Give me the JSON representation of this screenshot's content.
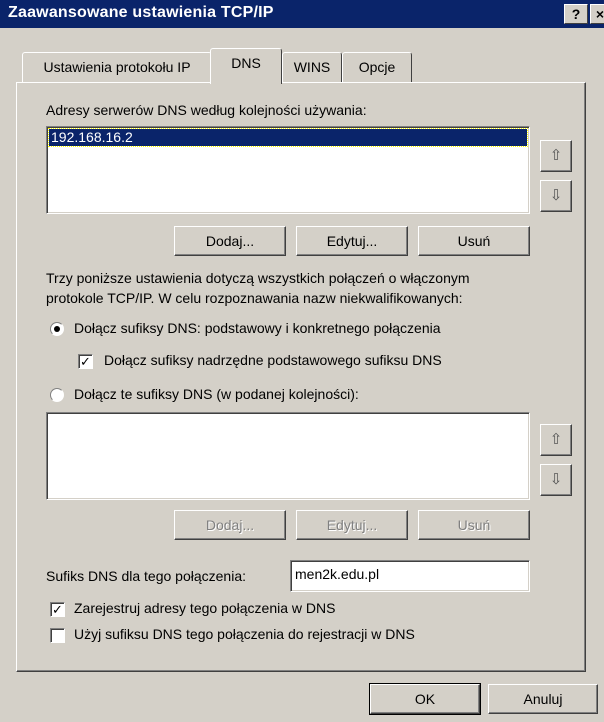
{
  "window": {
    "title": "Zaawansowane ustawienia TCP/IP",
    "help_label": "?",
    "close_label": "×"
  },
  "tabs": [
    {
      "label": "Ustawienia protokołu IP",
      "active": false
    },
    {
      "label": "DNS",
      "active": true
    },
    {
      "label": "WINS",
      "active": false
    },
    {
      "label": "Opcje",
      "active": false
    }
  ],
  "dns": {
    "servers_label": "Adresy serwerów DNS według kolejności używania:",
    "servers": [
      "192.168.16.2"
    ],
    "up_icon": "arrow-up-icon",
    "down_icon": "arrow-down-icon",
    "add_label": "Dodaj...",
    "edit_label": "Edytuj...",
    "remove_label": "Usuń",
    "info_text_line1": "Trzy poniższe ustawienia dotyczą wszystkich połączeń o włączonym",
    "info_text_line2": "protokole TCP/IP. W celu rozpoznawania nazw niekwalifikowanych:",
    "radio_primary_label": "Dołącz sufiksy DNS: podstawowy i konkretnego połączenia",
    "radio_primary_checked": true,
    "check_parent_label": "Dołącz sufiksy nadrzędne podstawowego sufiksu DNS",
    "check_parent_checked": true,
    "radio_custom_label": "Dołącz te sufiksy DNS (w podanej kolejności):",
    "radio_custom_checked": false,
    "suffixes": [],
    "suffix_add_label": "Dodaj...",
    "suffix_edit_label": "Edytuj...",
    "suffix_remove_label": "Usuń",
    "conn_suffix_label": "Sufiks DNS dla tego połączenia:",
    "conn_suffix_value": "men2k.edu.pl",
    "register_label": "Zarejestruj adresy tego połączenia w DNS",
    "register_checked": true,
    "use_suffix_label": "Użyj sufiksu DNS tego połączenia do rejestracji w DNS",
    "use_suffix_checked": false
  },
  "footer": {
    "ok_label": "OK",
    "cancel_label": "Anuluj"
  }
}
